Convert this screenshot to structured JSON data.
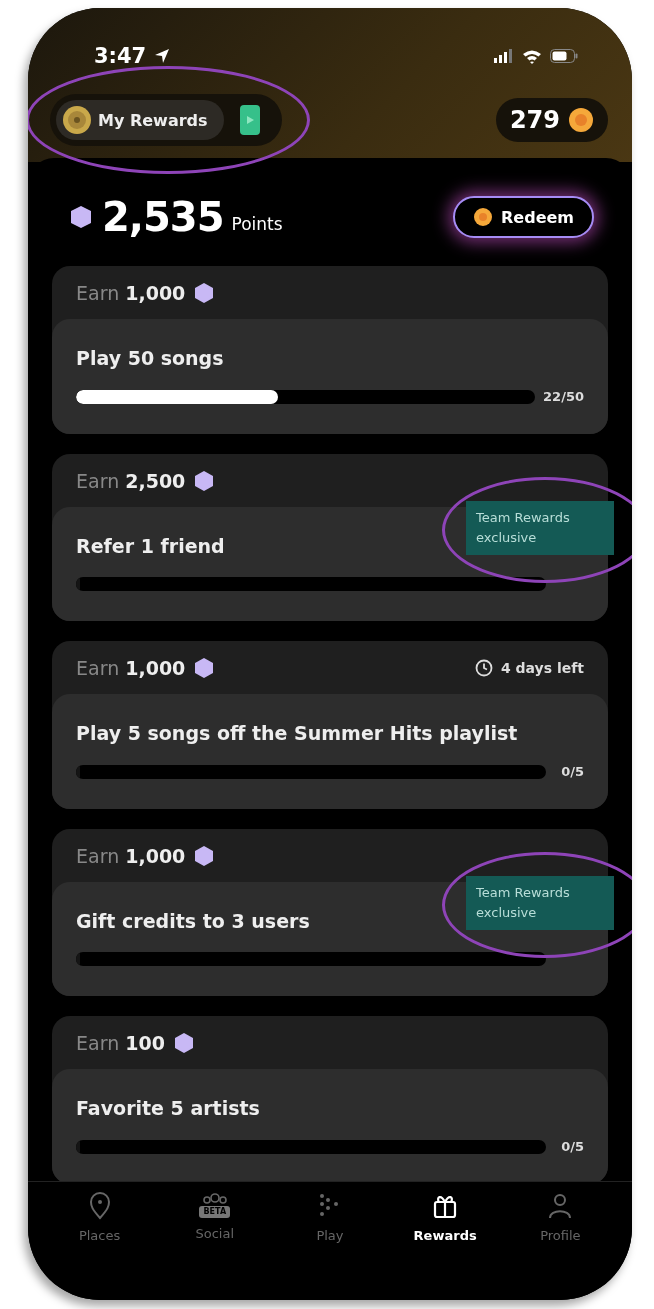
{
  "status_bar": {
    "time": "3:47"
  },
  "header": {
    "my_rewards": {
      "label": "My Rewards",
      "annotated": true
    },
    "coins": "279"
  },
  "points": {
    "value": "2,535",
    "unit": "Points",
    "redeem": "Redeem"
  },
  "tasks": [
    {
      "earn_label": "Earn",
      "earn_amount": "1,000",
      "title": "Play 50 songs",
      "level": 0.44,
      "reading": "22/50"
    },
    {
      "earn_label": "Earn",
      "earn_amount": "2,500",
      "title": "Refer 1 friend",
      "level": 0,
      "badge": "Team Rewards exclusive",
      "annotated": true
    },
    {
      "earn_label": "Earn",
      "earn_amount": "1,000",
      "time_left": "4 days left",
      "title": "Play 5 songs off the Summer Hits playlist",
      "level": 0,
      "reading": "0/5"
    },
    {
      "earn_label": "Earn",
      "earn_amount": "1,000",
      "title": "Gift credits to 3 users",
      "level": 0,
      "badge": "Team Rewards exclusive",
      "annotated": true
    },
    {
      "earn_label": "Earn",
      "earn_amount": "100",
      "title": "Favorite 5 artists",
      "level": 0,
      "reading": "0/5"
    }
  ],
  "nav": [
    {
      "kind": "pin",
      "label": "Places",
      "selected": false
    },
    {
      "kind": "social",
      "label": "Social",
      "badge": "BETA",
      "selected": false
    },
    {
      "kind": "dots",
      "label": "Play",
      "selected": false
    },
    {
      "kind": "gift",
      "label": "Rewards",
      "selected": true
    },
    {
      "kind": "person",
      "label": "Profile",
      "selected": false
    }
  ]
}
